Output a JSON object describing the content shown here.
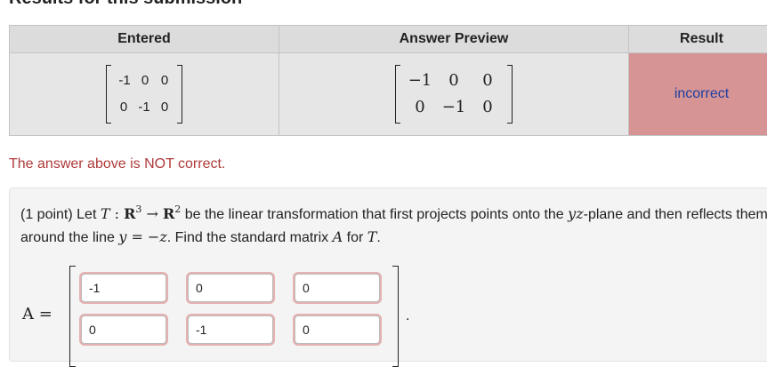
{
  "page": {
    "heading": "Results for this submission"
  },
  "results_table": {
    "headers": {
      "entered": "Entered",
      "preview": "Answer Preview",
      "result": "Result"
    },
    "entered_matrix": [
      [
        "-1",
        "0",
        "0"
      ],
      [
        "0",
        "-1",
        "0"
      ]
    ],
    "preview_matrix": [
      [
        "−1",
        "0",
        "0"
      ],
      [
        "0",
        "−1",
        "0"
      ]
    ],
    "result": "incorrect",
    "result_color": "#d69494"
  },
  "feedback": {
    "message": "The answer above is NOT correct."
  },
  "problem": {
    "points": "(1 point)",
    "line1_a": "Let ",
    "T": "T",
    "colon": " : ",
    "R": "R",
    "exp3": "3",
    "arrow": " → ",
    "exp2": "2",
    "line1_b": " be the linear transformation that first projects points onto the ",
    "yz": "yz",
    "line1_c": "-plane and then reflects them",
    "line2_a": "around the line ",
    "eq": "y = −z",
    "line2_b": ". Find the standard matrix ",
    "A": "A",
    "line2_c": " for ",
    "line2_d": ".",
    "matrix_label": "A =",
    "answer_inputs": [
      [
        "-1",
        "0",
        "0"
      ],
      [
        "0",
        "-1",
        "0"
      ]
    ],
    "period": "."
  }
}
